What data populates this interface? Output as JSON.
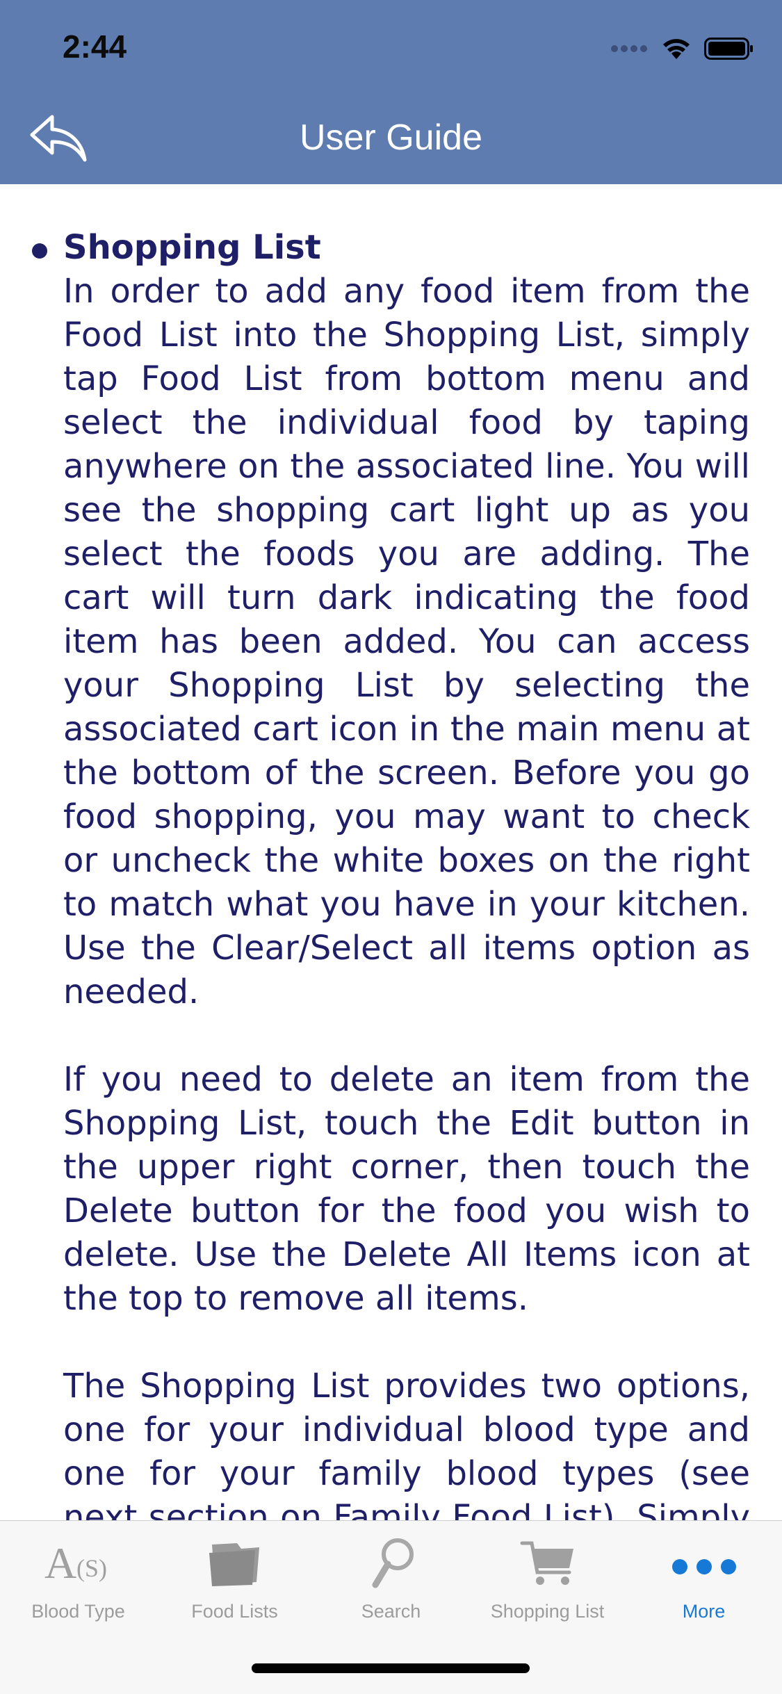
{
  "status": {
    "time": "2:44"
  },
  "nav": {
    "title": "User Guide"
  },
  "section": {
    "title": "Shopping List",
    "paragraphs": [
      "In order to add any food item from the Food List into the Shopping List, simply tap Food List from bottom menu and select the individual food by taping anywhere on the associated line. You will see the shopping cart light up as you select the foods you are adding. The cart will turn dark indicating the food item has been added. You can access your Shopping List by selecting the associated cart icon in the main menu at the bottom of the screen. Before you go food shopping, you may want to check or uncheck the white boxes on the right to match what you have in your kitchen. Use the Clear/Select all items option as needed.",
      "If you need to delete an item from the Shopping List, touch the Edit button in the upper right corner, then touch the Delete button for the food you wish to delete. Use the Delete All Items icon at the top to remove all items.",
      "The Shopping List provides two options, one for your individual blood type and one for your family blood types (see next section on Family Food List). Simply tap"
    ]
  },
  "tabs": [
    {
      "label": "Blood Type",
      "icon": "blood-type-icon",
      "icon_text": "A(S)"
    },
    {
      "label": "Food Lists",
      "icon": "folder-icon"
    },
    {
      "label": "Search",
      "icon": "magnifier-icon"
    },
    {
      "label": "Shopping List",
      "icon": "cart-icon"
    },
    {
      "label": "More",
      "icon": "more-dots-icon",
      "active": true
    }
  ],
  "colors": {
    "nav_background": "#5e7cb0",
    "text": "#1e1f67",
    "tab_active": "#1679d6",
    "tab_inactive": "#9c9c9c"
  }
}
